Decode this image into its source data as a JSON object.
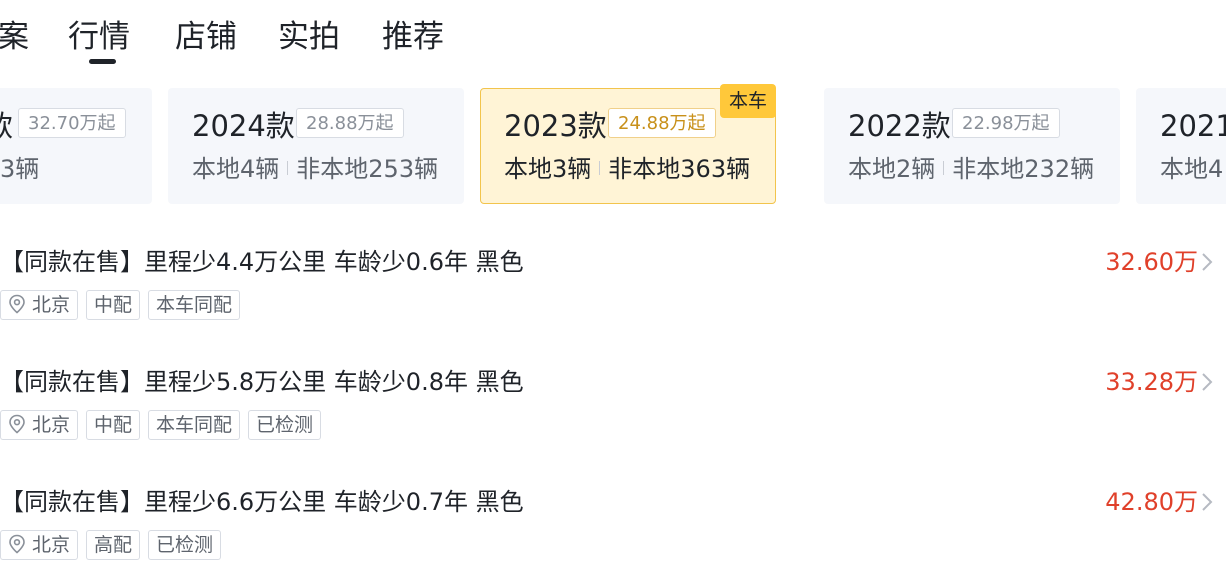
{
  "tabs": [
    {
      "label": "案",
      "active": false
    },
    {
      "label": "行情",
      "active": true
    },
    {
      "label": "店铺",
      "active": false
    },
    {
      "label": "实拍",
      "active": false
    },
    {
      "label": "推荐",
      "active": false
    }
  ],
  "year_cards": [
    {
      "title": "款",
      "price": "32.70万起",
      "local": "",
      "nonlocal": "3辆",
      "current": false
    },
    {
      "title": "2024款",
      "price": "28.88万起",
      "local": "本地4辆",
      "nonlocal": "非本地253辆",
      "current": false
    },
    {
      "title": "2023款",
      "price": "24.88万起",
      "local": "本地3辆",
      "nonlocal": "非本地363辆",
      "current": true,
      "badge": "本车"
    },
    {
      "title": "2022款",
      "price": "22.98万起",
      "local": "本地2辆",
      "nonlocal": "非本地232辆",
      "current": false
    },
    {
      "title": "2021",
      "price": "",
      "local": "本地4",
      "nonlocal": "",
      "current": false
    }
  ],
  "listings": [
    {
      "title": "【同款在售】里程少4.4万公里 车龄少0.6年 黑色",
      "price": "32.60万",
      "location": "北京",
      "tags": [
        "中配",
        "本车同配"
      ]
    },
    {
      "title": "【同款在售】里程少5.8万公里 车龄少0.8年 黑色",
      "price": "33.28万",
      "location": "北京",
      "tags": [
        "中配",
        "本车同配",
        "已检测"
      ]
    },
    {
      "title": "【同款在售】里程少6.6万公里 车龄少0.7年 黑色",
      "price": "42.80万",
      "location": "北京",
      "tags": [
        "高配",
        "已检测"
      ]
    }
  ],
  "icons": {
    "location": "location-pin-icon",
    "chevron": "chevron-right-icon"
  },
  "colors": {
    "price": "#e0402a",
    "current_card_bg": "#fff4d6",
    "badge": "#ffc83a"
  }
}
